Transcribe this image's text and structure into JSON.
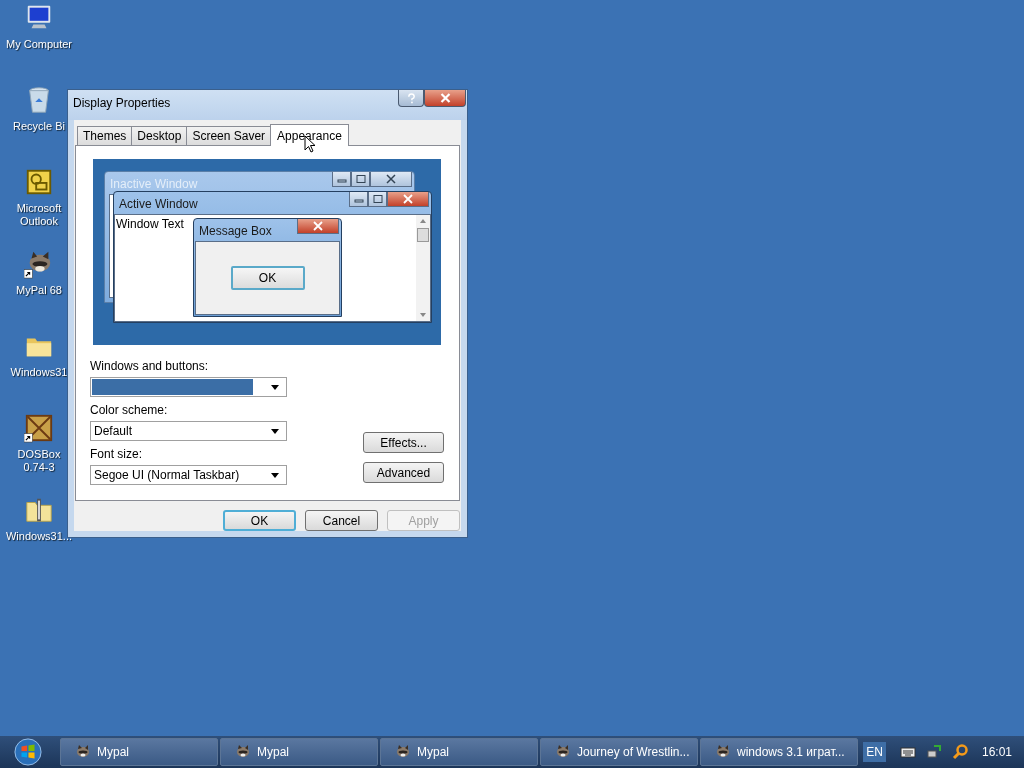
{
  "desktop_icons": [
    {
      "label": "My Computer",
      "kind": "computer",
      "shortcut": false
    },
    {
      "label": "Recycle Bi",
      "kind": "recycle",
      "shortcut": false
    },
    {
      "label": "Microsoft Outlook",
      "kind": "outlook",
      "shortcut": false
    },
    {
      "label": "MyPal 68",
      "kind": "raccoon",
      "shortcut": true
    },
    {
      "label": "Windows31",
      "kind": "folder",
      "shortcut": false
    },
    {
      "label": "DOSBox 0.74-3",
      "kind": "dosbox",
      "shortcut": true
    },
    {
      "label": "Windows31...",
      "kind": "zip",
      "shortcut": false
    }
  ],
  "dialog": {
    "title": "Display Properties",
    "tabs": [
      {
        "label": "Themes",
        "selected": false
      },
      {
        "label": "Desktop",
        "selected": false
      },
      {
        "label": "Screen Saver",
        "selected": false
      },
      {
        "label": "Appearance",
        "selected": true
      }
    ],
    "preview": {
      "inactive_title": "Inactive Window",
      "active_title": "Active Window",
      "window_text": "Window Text",
      "message_title": "Message Box",
      "message_button": "OK"
    },
    "fields": [
      {
        "label": "Windows and buttons:",
        "highlighted": true
      },
      {
        "label": "Color scheme:",
        "value": "Default",
        "highlighted": false
      },
      {
        "label": "Font size:",
        "value": "Segoe UI (Normal Taskbar)",
        "highlighted": false
      }
    ],
    "side_buttons": [
      "Effects...",
      "Advanced"
    ],
    "buttons": [
      {
        "label": "OK",
        "default": true,
        "disabled": false
      },
      {
        "label": "Cancel",
        "default": false,
        "disabled": false
      },
      {
        "label": "Apply",
        "default": false,
        "disabled": true
      }
    ]
  },
  "taskbar": {
    "tasks": [
      "Mypal",
      "Mypal",
      "Mypal",
      "Journey of Wrestlin...",
      "windows 3.1 играт..."
    ],
    "language": "EN",
    "clock": "16:01"
  }
}
